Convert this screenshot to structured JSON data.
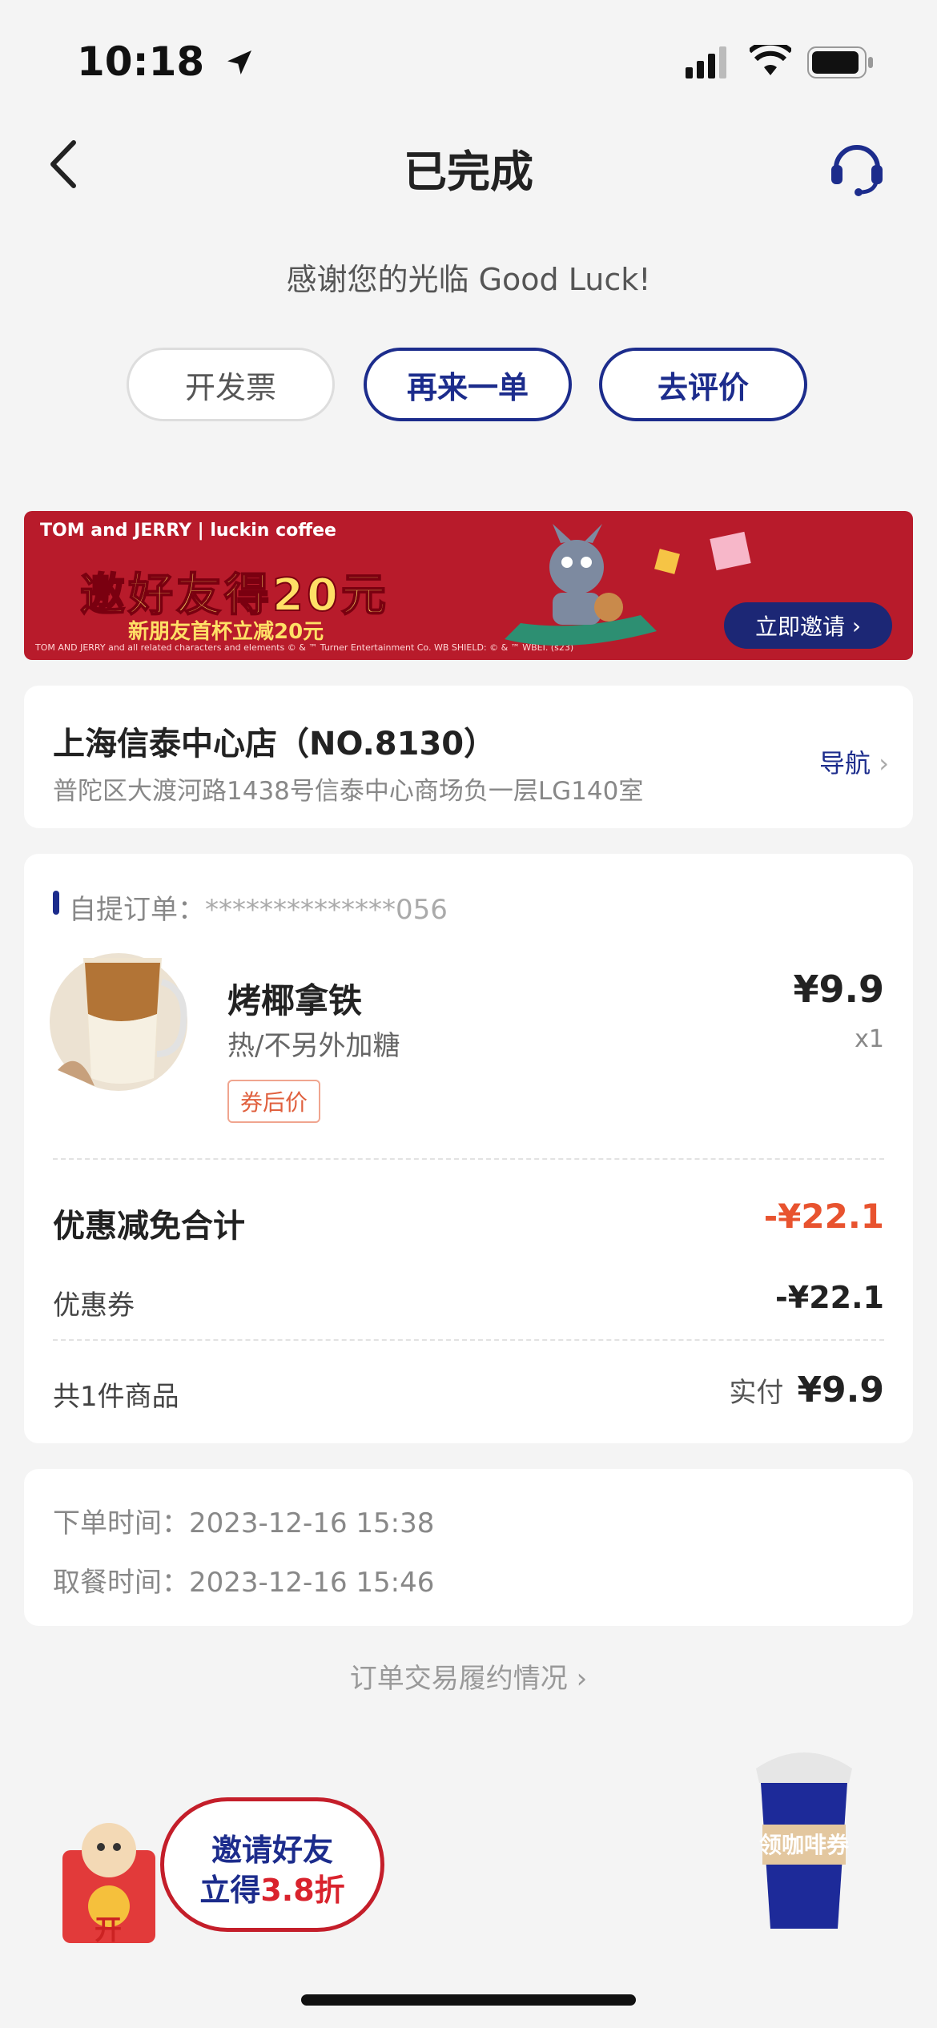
{
  "status_bar": {
    "time": "10:18"
  },
  "nav": {
    "title": "已完成"
  },
  "thanks": "感谢您的光临 Good Luck!",
  "actions": {
    "invoice": "开发票",
    "reorder": "再来一单",
    "review": "去评价"
  },
  "banner": {
    "brand": "TOM and JERRY | luckin coffee",
    "headline": "邀好友得20元",
    "sub": "新朋友首杯立减20元",
    "fine_print": "TOM AND JERRY and all related characters and elements © & ™ Turner Entertainment Co. WB SHIELD: © & ™ WBEI. (s23)",
    "button": "立即邀请"
  },
  "store": {
    "name": "上海信泰中心店（NO.8130）",
    "address": "普陀区大渡河路1438号信泰中心商场负一层LG140室",
    "nav_label": "导航"
  },
  "order": {
    "label": "自提订单：",
    "number": "**************056",
    "item": {
      "name": "烤椰拿铁",
      "spec": "热/不另外加糖",
      "tag": "券后价",
      "price": "¥9.9",
      "qty": "x1"
    },
    "discount_total_label": "优惠减免合计",
    "discount_total": "-¥22.1",
    "coupon_label": "优惠券",
    "coupon_value": "-¥22.1",
    "count_label": "共1件商品",
    "paid_label": "实付",
    "paid_value": "¥9.9"
  },
  "times": {
    "order_label": "下单时间：",
    "order_time": "2023-12-16 15:38",
    "pickup_label": "取餐时间：",
    "pickup_time": "2023-12-16 15:46"
  },
  "fulfillment_link": "订单交易履约情况",
  "promo": {
    "line1": "邀请好友",
    "line2_prefix": "立得",
    "line2_highlight": "3.8折",
    "envelope": "开"
  },
  "coffee_coupon": "领咖啡券",
  "colors": {
    "brand_blue": "#1c2c8c",
    "discount_red": "#e8532f",
    "banner_red": "#b81b2b"
  }
}
